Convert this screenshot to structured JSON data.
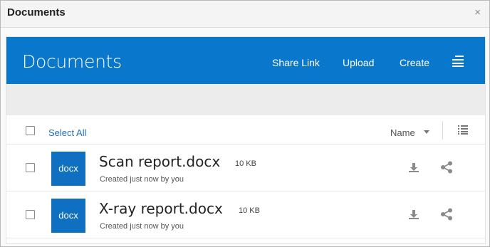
{
  "dialog": {
    "title": "Documents",
    "close_glyph": "×"
  },
  "banner": {
    "title": "Documents",
    "actions": [
      "Share Link",
      "Upload",
      "Create"
    ],
    "menu_icon": "menu-icon",
    "background": "#0978cc"
  },
  "list_header": {
    "select_all": "Select All",
    "sort_by": "Name",
    "view_icon": "list-view-icon"
  },
  "files": [
    {
      "thumb": "docx",
      "name": "Scan report.docx",
      "size": "10 KB",
      "meta": "Created just now by you"
    },
    {
      "thumb": "docx",
      "name": "X-ray report.docx",
      "size": "10 KB",
      "meta": "Created just now by you"
    }
  ],
  "colors": {
    "accent": "#0978cc",
    "thumb": "#0f6fc1",
    "link": "#1e6fb5"
  }
}
